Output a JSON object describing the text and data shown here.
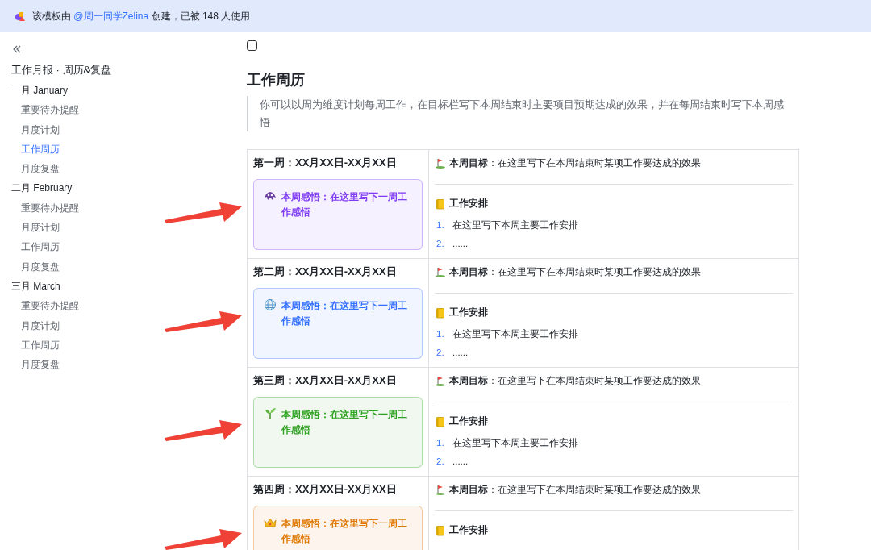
{
  "banner": {
    "before": "该模板由 ",
    "link": "@周一同学Zelina",
    "after": " 创建，已被 148 人使用"
  },
  "sidebar": {
    "title": "工作月报 · 周历&复盘",
    "groups": [
      {
        "label": "一月 January",
        "children": [
          {
            "label": "重要待办提醒",
            "selected": false
          },
          {
            "label": "月度计划",
            "selected": false
          },
          {
            "label": "工作周历",
            "selected": true
          },
          {
            "label": "月度复盘",
            "selected": false
          }
        ]
      },
      {
        "label": "二月 February",
        "children": [
          {
            "label": "重要待办提醒",
            "selected": false
          },
          {
            "label": "月度计划",
            "selected": false
          },
          {
            "label": "工作周历",
            "selected": false
          },
          {
            "label": "月度复盘",
            "selected": false
          }
        ]
      },
      {
        "label": "三月 March",
        "children": [
          {
            "label": "重要待办提醒",
            "selected": false
          },
          {
            "label": "月度计划",
            "selected": false
          },
          {
            "label": "工作周历",
            "selected": false
          },
          {
            "label": "月度复盘",
            "selected": false
          }
        ]
      }
    ]
  },
  "page": {
    "checked": false,
    "title": "工作周历",
    "quote": "你可以以周为维度计划每周工作，在目标栏写下本周结束时主要项目预期达成的效果，并在每周结束时写下本周感悟"
  },
  "weeks": [
    {
      "heading": "第一周：XX月XX日-XX月XX日",
      "arrow": true,
      "reflection": {
        "text": "本周感悟：在这里写下一周工作感悟",
        "color": "#7f3bf5"
      },
      "goal": "**本周目标**：在这里写下在本周结束时某项工作要达成的效果",
      "plan": {
        "title": "工作安排",
        "items": [
          {
            "number": "1.",
            "text": "在这里写下本周主要工作安排"
          },
          {
            "number": "2.",
            "text": "......"
          }
        ]
      }
    },
    {
      "heading": "第二周：XX月XX日-XX月XX日",
      "arrow": true,
      "reflection": {
        "text": "本周感悟：在这里写下一周工作感悟",
        "color": "#3370ff"
      },
      "goal": "**本周目标**：在这里写下在本周结束时某项工作要达成的效果",
      "plan": {
        "title": "工作安排",
        "items": [
          {
            "number": "1.",
            "text": "在这里写下本周主要工作安排"
          },
          {
            "number": "2.",
            "text": "......"
          }
        ]
      }
    },
    {
      "heading": "第三周：XX月XX日-XX月XX日",
      "arrow": true,
      "reflection": {
        "text": "本周感悟：在这里写下一周工作感悟",
        "color": "#2ea121"
      },
      "goal": "**本周目标**：在这里写下在本周结束时某项工作要达成的效果",
      "plan": {
        "title": "工作安排",
        "items": [
          {
            "number": "1.",
            "text": "在这里写下本周主要工作安排"
          },
          {
            "number": "2.",
            "text": "......"
          }
        ]
      }
    },
    {
      "heading": "第四周：XX月XX日-XX月XX日",
      "arrow": true,
      "reflection": {
        "text": "本周感悟：在这里写下一周工作感悟",
        "color": "#de7802"
      },
      "goal": "**本周目标**：在这里写下在本周结束时某项工作要达成的效果",
      "plan": {
        "title": "工作安排"
      }
    }
  ]
}
